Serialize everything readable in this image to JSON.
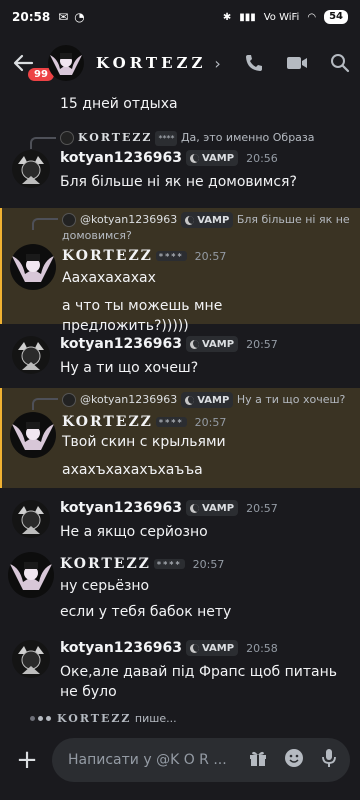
{
  "status": {
    "time": "20:58",
    "battery": "54",
    "net": "Vo WiFi"
  },
  "header": {
    "title": "KORTEZZ",
    "badge": "99"
  },
  "top_line": "15 дней отдыха",
  "messages": [
    {
      "reply": {
        "name": "KORTEZZ",
        "tag": "****",
        "text": "Да, это именно Образа"
      },
      "author": "kotyan1236963",
      "clan": "VAMP",
      "time": "20:56",
      "lines": [
        "Бля більше ні як не домовимся?"
      ]
    },
    {
      "reply": {
        "name": "@kotyan1236963",
        "clan": "VAMP",
        "text": "Бля більше ні як не домовимся?"
      },
      "author": "KORTEZZ",
      "tag": "****",
      "time": "20:57",
      "lines": [
        "Аахахахахах",
        "а что ты можешь мне предложить?)))))"
      ]
    },
    {
      "author": "kotyan1236963",
      "clan": "VAMP",
      "time": "20:57",
      "lines": [
        "Ну а ти що хочеш?"
      ]
    },
    {
      "reply": {
        "name": "@kotyan1236963",
        "clan": "VAMP",
        "text": "Ну а ти що хочеш?"
      },
      "author": "KORTEZZ",
      "tag": "****",
      "time": "20:57",
      "lines": [
        "Твой скин с крыльями",
        "ахахъхахахъхаъъа"
      ]
    },
    {
      "author": "kotyan1236963",
      "clan": "VAMP",
      "time": "20:57",
      "lines": [
        "Не а якщо серйозно"
      ]
    },
    {
      "author": "KORTEZZ",
      "tag": "****",
      "time": "20:57",
      "lines": [
        "ну серьёзно",
        "если у тебя бабок нету"
      ]
    },
    {
      "author": "kotyan1236963",
      "clan": "VAMP",
      "time": "20:58",
      "lines": [
        "Оке,але давай під Фрапс щоб питань не було"
      ]
    }
  ],
  "typing": {
    "name": "KORTEZZ",
    "suffix": " пише..."
  },
  "composer": {
    "placeholder": "Написати у @K O R ..."
  },
  "colors": {
    "background": "#1a1a1e",
    "highlight": "#3a3323",
    "highlight_border": "#f0b232",
    "badge": "#ed4245"
  }
}
